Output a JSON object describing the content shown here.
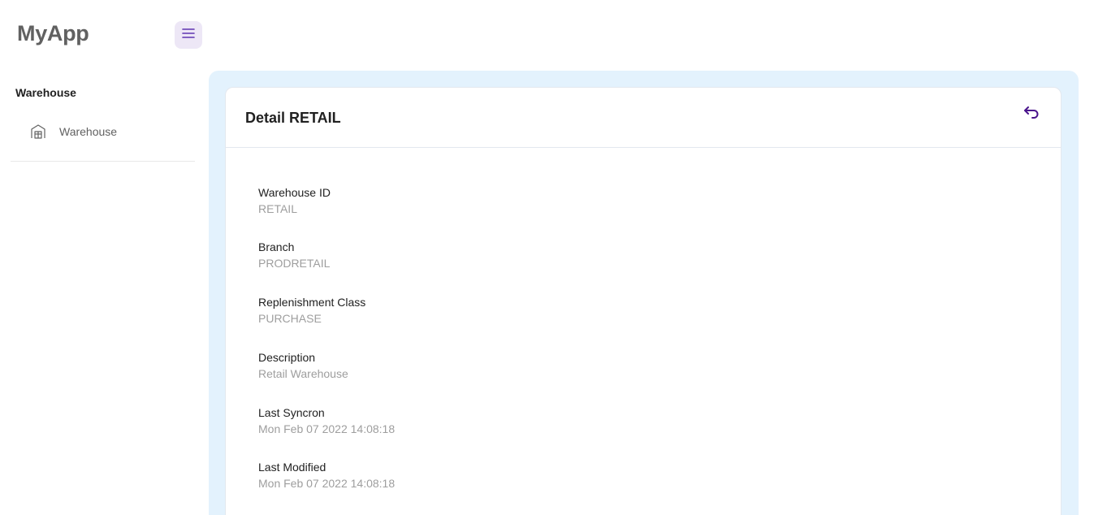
{
  "app": {
    "title": "MyApp"
  },
  "header": {
    "menu_icon": "hamburger-menu-icon"
  },
  "sidebar": {
    "heading": "Warehouse",
    "items": [
      {
        "label": "Warehouse",
        "icon": "warehouse-icon"
      }
    ]
  },
  "detail": {
    "title": "Detail RETAIL",
    "back_icon": "undo-arrow-icon",
    "fields": [
      {
        "label": "Warehouse ID",
        "value": "RETAIL"
      },
      {
        "label": "Branch",
        "value": "PRODRETAIL"
      },
      {
        "label": "Replenishment Class",
        "value": "PURCHASE"
      },
      {
        "label": "Description",
        "value": "Retail Warehouse"
      },
      {
        "label": "Last Syncron",
        "value": "Mon Feb 07 2022 14:08:18"
      },
      {
        "label": "Last Modified",
        "value": "Mon Feb 07 2022 14:08:18"
      }
    ]
  },
  "colors": {
    "accent": "#5e35b1",
    "accent_bg": "#ede7f6",
    "main_bg": "#e3f2fd",
    "back_icon": "#4a148c"
  }
}
